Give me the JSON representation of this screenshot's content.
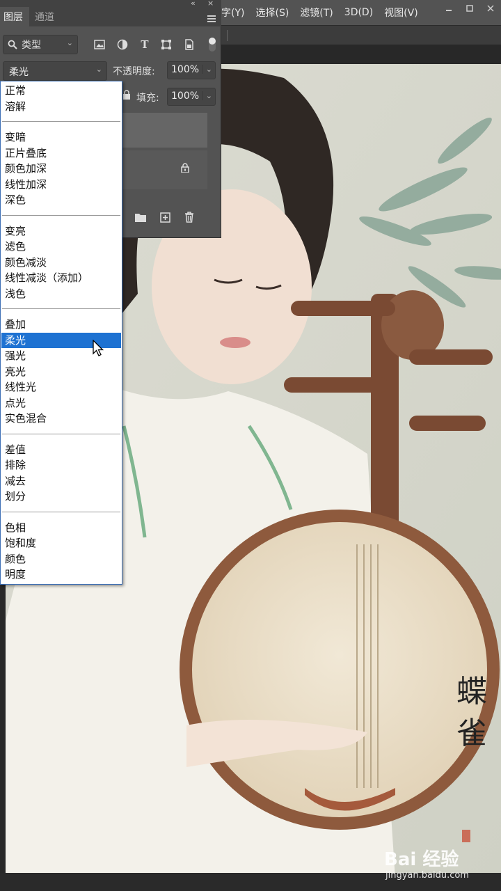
{
  "menubar": {
    "items": [
      "字(Y)",
      "选择(S)",
      "滤镜(T)",
      "3D(D)",
      "视图(V)"
    ]
  },
  "layers_panel": {
    "tabs": [
      "图层",
      "通道"
    ],
    "filter_kind": "类型",
    "blend_mode": "柔光",
    "opacity_label": "不透明度:",
    "opacity_value": "100%",
    "fill_label": "填充:",
    "fill_value": "100%"
  },
  "blend_dropdown": {
    "groups": [
      [
        "正常",
        "溶解"
      ],
      [
        "变暗",
        "正片叠底",
        "颜色加深",
        "线性加深",
        "深色"
      ],
      [
        "变亮",
        "滤色",
        "颜色减淡",
        "线性减淡（添加）",
        "浅色"
      ],
      [
        "叠加",
        "柔光",
        "强光",
        "亮光",
        "线性光",
        "点光",
        "实色混合"
      ],
      [
        "差值",
        "排除",
        "减去",
        "划分"
      ],
      [
        "色相",
        "饱和度",
        "颜色",
        "明度"
      ]
    ],
    "selected": "柔光"
  },
  "artwork": {
    "calligraphy": [
      "蝶",
      "雀"
    ]
  },
  "watermark": {
    "logo": "Bai 经验",
    "url": "jingyan.baidu.com"
  }
}
